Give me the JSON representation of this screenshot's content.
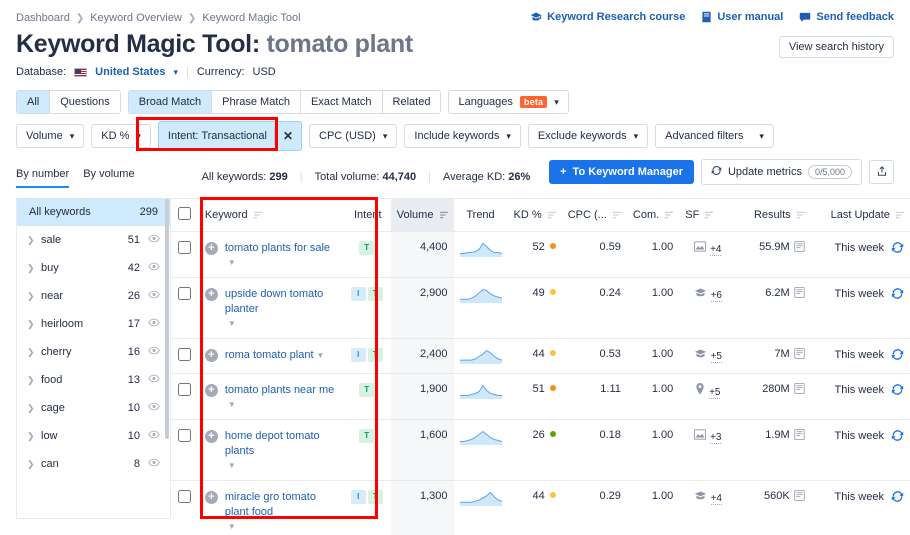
{
  "breadcrumb": [
    "Dashboard",
    "Keyword Overview",
    "Keyword Magic Tool"
  ],
  "header_links": [
    {
      "label": "Keyword Research course",
      "icon": "graduation-cap-icon"
    },
    {
      "label": "User manual",
      "icon": "book-icon"
    },
    {
      "label": "Send feedback",
      "icon": "speech-bubble-icon"
    }
  ],
  "history_button": "View search history",
  "title": {
    "main": "Keyword Magic Tool:",
    "keyword": "tomato plant"
  },
  "meta": {
    "database_label": "Database:",
    "database_value": "United States",
    "currency_label": "Currency:",
    "currency_value": "USD"
  },
  "filters": {
    "match_group_1": [
      {
        "label": "All",
        "active": true
      },
      {
        "label": "Questions",
        "active": false
      }
    ],
    "match_group_2": [
      {
        "label": "Broad Match",
        "active": true
      },
      {
        "label": "Phrase Match",
        "active": false
      },
      {
        "label": "Exact Match",
        "active": false
      },
      {
        "label": "Related",
        "active": false
      }
    ],
    "languages": {
      "label": "Languages",
      "badge": "beta"
    },
    "row2": [
      {
        "label": "Volume",
        "type": "dropdown"
      },
      {
        "label": "KD %",
        "type": "dropdown"
      },
      {
        "label": "Intent: Transactional",
        "type": "active-chip",
        "close": "✕"
      },
      {
        "label": "CPC (USD)",
        "type": "dropdown"
      },
      {
        "label": "Include keywords",
        "type": "dropdown"
      },
      {
        "label": "Exclude keywords",
        "type": "dropdown"
      },
      {
        "label": "Advanced filters",
        "type": "dropdown"
      }
    ]
  },
  "view_tabs": [
    {
      "label": "By number",
      "active": true
    },
    {
      "label": "By volume",
      "active": false
    }
  ],
  "totals": {
    "all_keywords_label": "All keywords:",
    "all_keywords_value": "299",
    "total_volume_label": "Total volume:",
    "total_volume_value": "44,740",
    "average_kd_label": "Average KD:",
    "average_kd_value": "26%"
  },
  "actions": {
    "to_keyword_manager": "To Keyword Manager",
    "update_metrics": "Update metrics",
    "update_counter": "0/5,000",
    "export_icon": "export-icon"
  },
  "sidebar": {
    "header_label": "All keywords",
    "header_count": "299",
    "items": [
      {
        "label": "sale",
        "count": "51"
      },
      {
        "label": "buy",
        "count": "42"
      },
      {
        "label": "near",
        "count": "26"
      },
      {
        "label": "heirloom",
        "count": "17"
      },
      {
        "label": "cherry",
        "count": "16"
      },
      {
        "label": "food",
        "count": "13"
      },
      {
        "label": "cage",
        "count": "10"
      },
      {
        "label": "low",
        "count": "10"
      },
      {
        "label": "can",
        "count": "8"
      }
    ]
  },
  "table": {
    "columns": [
      {
        "key": "checkbox",
        "label": "",
        "align": "c",
        "sortable": false
      },
      {
        "key": "keyword",
        "label": "Keyword",
        "align": "l",
        "sortable": true
      },
      {
        "key": "intent",
        "label": "Intent",
        "align": "c",
        "sortable": false
      },
      {
        "key": "volume",
        "label": "Volume",
        "align": "r",
        "sortable": true,
        "sorted": true
      },
      {
        "key": "trend",
        "label": "Trend",
        "align": "c",
        "sortable": false
      },
      {
        "key": "kd",
        "label": "KD %",
        "align": "r",
        "sortable": true
      },
      {
        "key": "cpc",
        "label": "CPC (...",
        "align": "r",
        "sortable": true
      },
      {
        "key": "com",
        "label": "Com.",
        "align": "r",
        "sortable": true
      },
      {
        "key": "sf",
        "label": "SF",
        "align": "l",
        "sortable": true
      },
      {
        "key": "results",
        "label": "Results",
        "align": "r",
        "sortable": true
      },
      {
        "key": "update",
        "label": "Last Update",
        "align": "r",
        "sortable": true
      }
    ],
    "rows": [
      {
        "keyword": "tomato plants for sale",
        "intent": [
          "T"
        ],
        "volume": "4,400",
        "trend": [
          2,
          2,
          3,
          3,
          4,
          6,
          12,
          9,
          5,
          3,
          3,
          2
        ],
        "kd": "52",
        "kd_color": "#f2921d",
        "cpc": "0.59",
        "com": "1.00",
        "sf_icon": "image-icon",
        "sf_more": "+4",
        "results": "55.9M",
        "update": "This week"
      },
      {
        "keyword": "upside down tomato planter",
        "intent": [
          "I",
          "T"
        ],
        "volume": "2,900",
        "trend": [
          2,
          2,
          2,
          3,
          5,
          8,
          11,
          10,
          7,
          5,
          4,
          3
        ],
        "kd": "49",
        "kd_color": "#fcc43c",
        "cpc": "0.24",
        "com": "1.00",
        "sf_icon": "graduation-icon",
        "sf_more": "+6",
        "results": "6.2M",
        "update": "This week"
      },
      {
        "keyword": "roma tomato plant",
        "intent": [
          "I",
          "T"
        ],
        "volume": "2,400",
        "trend": [
          2,
          2,
          2,
          2,
          3,
          5,
          7,
          10,
          8,
          5,
          3,
          2
        ],
        "kd": "44",
        "kd_color": "#fcc43c",
        "cpc": "0.53",
        "com": "1.00",
        "sf_icon": "graduation-icon",
        "sf_more": "+5",
        "results": "7M",
        "update": "This week"
      },
      {
        "keyword": "tomato plants near me",
        "intent": [
          "T"
        ],
        "volume": "1,900",
        "trend": [
          2,
          2,
          2,
          3,
          4,
          6,
          12,
          7,
          4,
          3,
          2,
          2
        ],
        "kd": "51",
        "kd_color": "#f2921d",
        "cpc": "1.11",
        "com": "1.00",
        "sf_icon": "location-pin-icon",
        "sf_more": "+5",
        "results": "280M",
        "update": "This week"
      },
      {
        "keyword": "home depot tomato plants",
        "intent": [
          "T"
        ],
        "volume": "1,600",
        "trend": [
          2,
          2,
          3,
          4,
          6,
          9,
          12,
          9,
          6,
          4,
          3,
          2
        ],
        "kd": "26",
        "kd_color": "#5aa700",
        "cpc": "0.18",
        "com": "1.00",
        "sf_icon": "image-icon",
        "sf_more": "+3",
        "results": "1.9M",
        "update": "This week"
      },
      {
        "keyword": "miracle gro tomato plant food",
        "intent": [
          "I",
          "T"
        ],
        "volume": "1,300",
        "trend": [
          2,
          2,
          2,
          2,
          3,
          4,
          6,
          8,
          11,
          7,
          4,
          3
        ],
        "kd": "44",
        "kd_color": "#fcc43c",
        "cpc": "0.29",
        "com": "1.00",
        "sf_icon": "graduation-icon",
        "sf_more": "+4",
        "results": "560K",
        "update": "This week"
      }
    ]
  },
  "annotations": {
    "highlight_color": "#fe0000",
    "boxes": [
      "intent-filter-chip",
      "keyword-intent-columns"
    ]
  }
}
